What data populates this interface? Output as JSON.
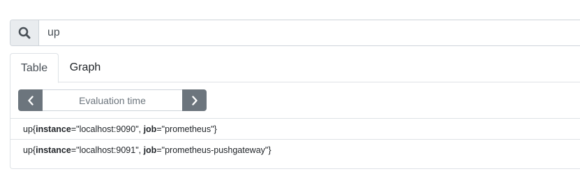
{
  "query": {
    "value": "up",
    "search_icon": "search-icon"
  },
  "tabs": [
    {
      "label": "Table",
      "active": true
    },
    {
      "label": "Graph",
      "active": false
    }
  ],
  "evaluation": {
    "placeholder": "Evaluation time",
    "prev_icon": "chevron-left-icon",
    "next_icon": "chevron-right-icon"
  },
  "results": [
    {
      "metric": "up",
      "labels": [
        {
          "name": "instance",
          "value": "localhost:9090"
        },
        {
          "name": "job",
          "value": "prometheus"
        }
      ]
    },
    {
      "metric": "up",
      "labels": [
        {
          "name": "instance",
          "value": "localhost:9091"
        },
        {
          "name": "job",
          "value": "prometheus-pushgateway"
        }
      ]
    }
  ],
  "colors": {
    "nav_button": "#6c757d",
    "border": "#dee2e6",
    "addon_bg": "#e9ecef"
  }
}
